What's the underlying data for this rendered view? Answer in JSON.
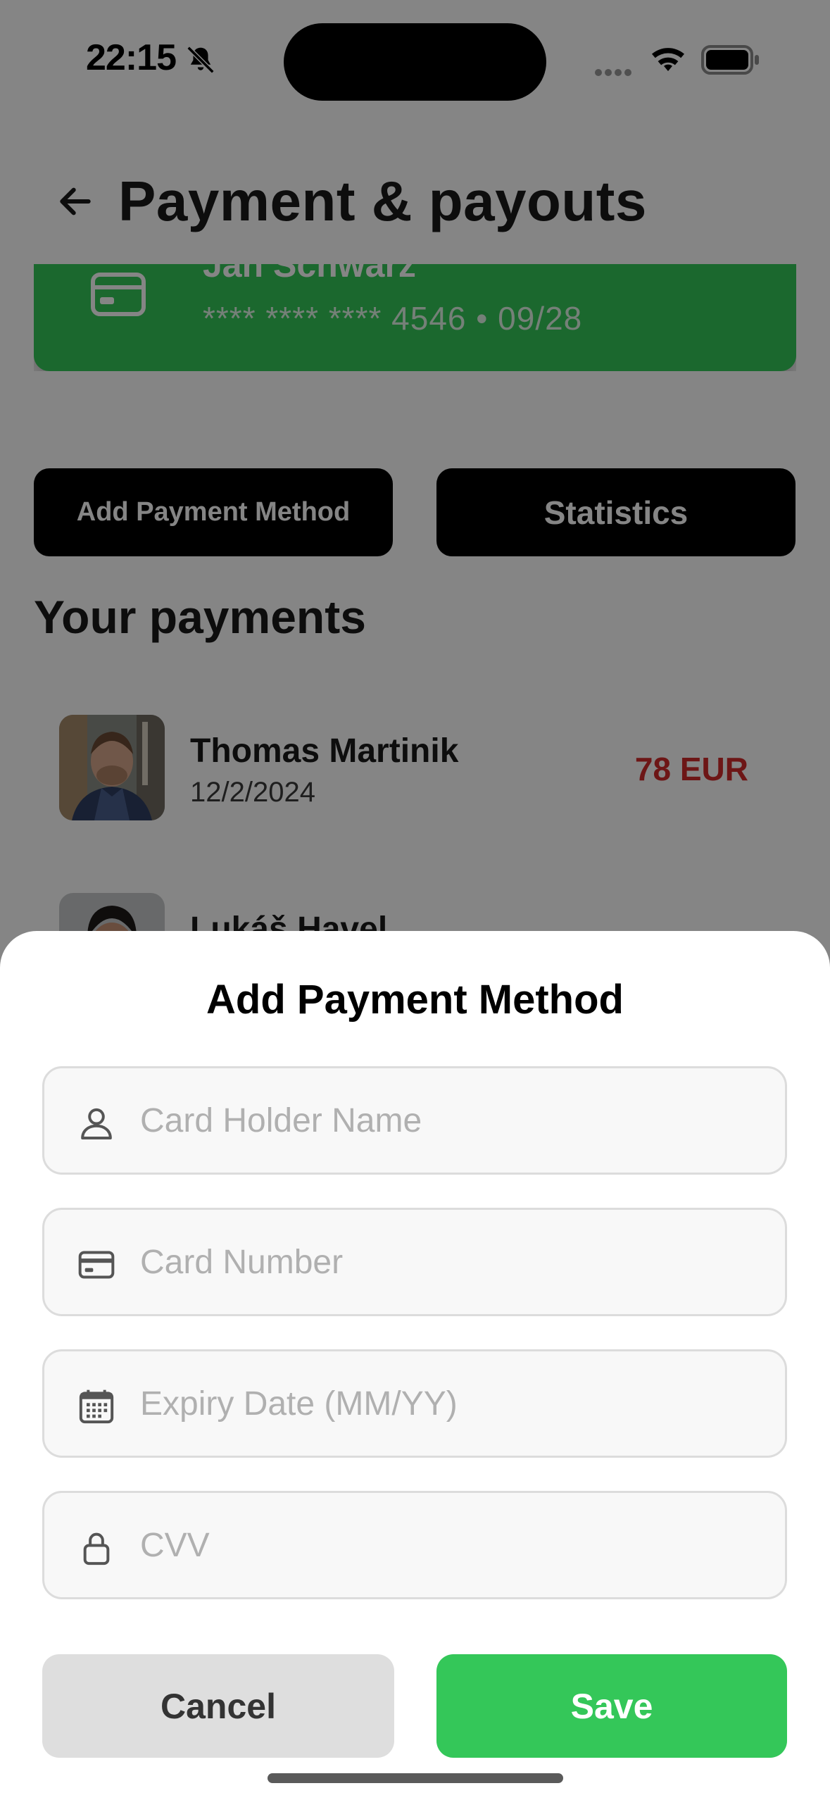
{
  "status_bar": {
    "time": "22:15"
  },
  "header": {
    "title": "Payment & payouts"
  },
  "card": {
    "holder": "Jan Schwarz",
    "masked_number": "**** **** **** 4546 • 09/28",
    "color": "#34c759"
  },
  "actions": {
    "add_payment_label": "Add Payment Method",
    "statistics_label": "Statistics"
  },
  "payments": {
    "title": "Your payments",
    "items": [
      {
        "name": "Thomas Martinik",
        "date": "12/2/2024",
        "amount": "78 EUR"
      },
      {
        "name": "Lukáš Havel"
      }
    ]
  },
  "sheet": {
    "title": "Add Payment Method",
    "fields": {
      "holder_placeholder": "Card Holder Name",
      "number_placeholder": "Card Number",
      "expiry_placeholder": "Expiry Date (MM/YY)",
      "cvv_placeholder": "CVV"
    },
    "cancel_label": "Cancel",
    "save_label": "Save"
  },
  "colors": {
    "accent_green": "#34c759",
    "amount_red": "#d12b2b"
  },
  "icons": [
    "bell-slash-icon",
    "wifi-icon",
    "battery-icon",
    "back-arrow-icon",
    "credit-card-icon",
    "person-icon",
    "calendar-icon",
    "lock-icon"
  ]
}
